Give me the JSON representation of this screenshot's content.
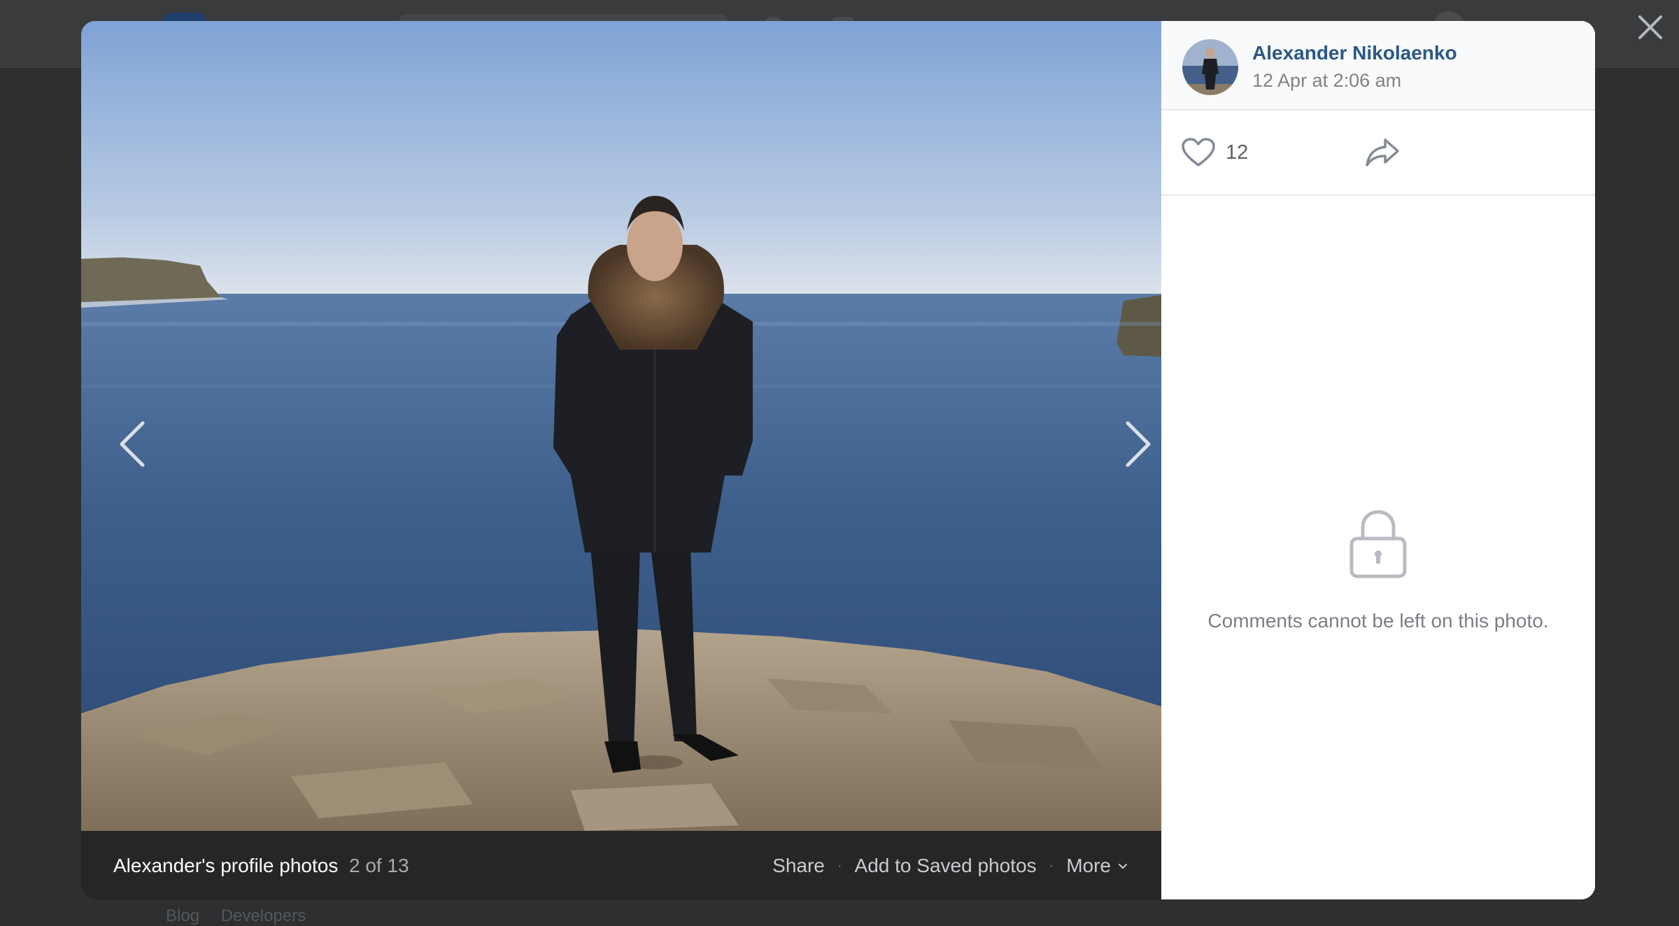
{
  "background_page": {
    "footer_links": [
      "Blog",
      "Developers"
    ]
  },
  "viewer": {
    "author": {
      "name": "Alexander Nikolaenko",
      "date": "12 Apr at 2:06 am"
    },
    "likes": "12",
    "album_title": "Alexander's profile photos",
    "counter": "2 of 13",
    "actions": {
      "share": "Share",
      "save": "Add to Saved photos",
      "more": "More"
    },
    "comments_notice": "Comments cannot be left on this photo."
  },
  "icons": {
    "close": "close-icon",
    "prev": "chevron-left-icon",
    "next": "chevron-right-icon",
    "like": "heart-icon",
    "share": "share-arrow-icon",
    "more": "chevron-down-icon",
    "lock": "lock-icon"
  },
  "colors": {
    "link": "#2a5885",
    "overlay": "#2e2f30",
    "photo_bar": "#262626"
  }
}
